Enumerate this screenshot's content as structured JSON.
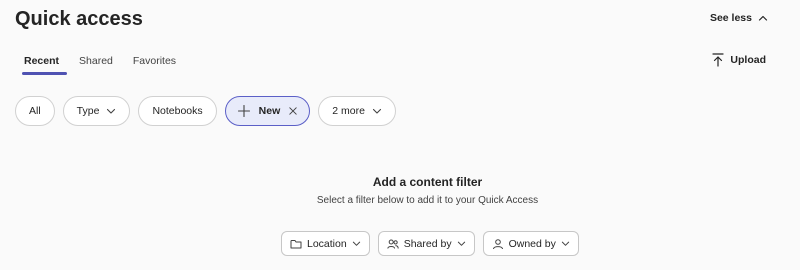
{
  "header": {
    "title": "Quick access",
    "see_less_label": "See less"
  },
  "tabs": [
    {
      "label": "Recent",
      "active": true
    },
    {
      "label": "Shared",
      "active": false
    },
    {
      "label": "Favorites",
      "active": false
    }
  ],
  "upload_label": "Upload",
  "chips": {
    "all": "All",
    "type": "Type",
    "notebooks": "Notebooks",
    "new": "New",
    "more": "2 more"
  },
  "empty_state": {
    "title": "Add a content filter",
    "subtitle": "Select a filter below to add it to your Quick Access"
  },
  "filters": {
    "location": "Location",
    "shared_by": "Shared by",
    "owned_by": "Owned by"
  },
  "colors": {
    "accent": "#5b5fc7",
    "accent_bg": "#e8ebfa",
    "tab_underline": "#4f52b2"
  }
}
